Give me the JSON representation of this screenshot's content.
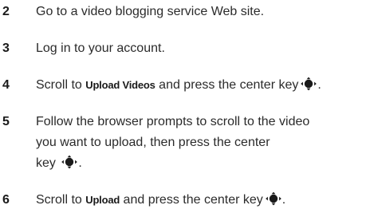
{
  "steps": [
    {
      "number": "2",
      "lines": [
        [
          "Go to a video blogging service Web site."
        ]
      ]
    },
    {
      "number": "3",
      "lines": [
        [
          "Log in to your account."
        ]
      ]
    },
    {
      "number": "4",
      "before": "Scroll to ",
      "keyword": "Upload Videos",
      "after": " and press the center key",
      "icon": "center-nav-key-icon"
    },
    {
      "number": "5",
      "line1": "Follow the browser prompts to scroll to the video",
      "line2": "you want to upload, then press the center",
      "line3": "key",
      "icon": "center-nav-key-icon"
    },
    {
      "number": "6",
      "before": "Scroll to ",
      "keyword": "Upload",
      "after": " and press the center key",
      "icon": "center-nav-key-icon"
    }
  ],
  "step2_text": "Go to a video blogging service Web site.",
  "step3_text": "Log in to your account."
}
